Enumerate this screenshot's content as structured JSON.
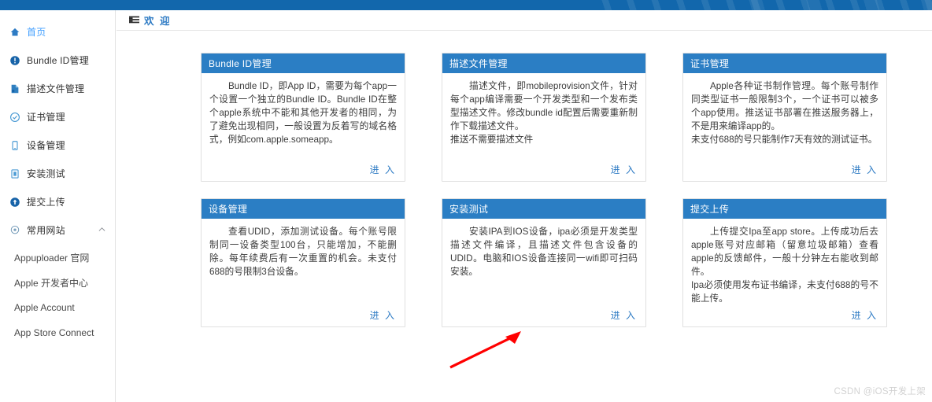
{
  "theme": {
    "topbar_bg": "#1267ac",
    "accent": "#2e7bc4",
    "card_header_bg": "#2b7ec4",
    "active_nav": "#409eff",
    "arrow": "#ff0000",
    "watermark": "#d2d2d2"
  },
  "sidebar": {
    "items": [
      {
        "label": "首页",
        "icon": "home-icon",
        "active": true
      },
      {
        "label": "Bundle ID管理",
        "icon": "info-circle-icon",
        "active": false
      },
      {
        "label": "描述文件管理",
        "icon": "file-profile-icon",
        "active": false
      },
      {
        "label": "证书管理",
        "icon": "check-circle-icon",
        "active": false
      },
      {
        "label": "设备管理",
        "icon": "mobile-device-icon",
        "active": false
      },
      {
        "label": "安装测试",
        "icon": "clipboard-install-icon",
        "active": false
      },
      {
        "label": "提交上传",
        "icon": "upload-circle-icon",
        "active": false
      },
      {
        "label": "常用网站",
        "icon": "location-pin-icon",
        "active": false,
        "expandable": true,
        "caret": "chevron-up-icon"
      }
    ],
    "sub_items": [
      {
        "label": "Appuploader 官网"
      },
      {
        "label": "Apple 开发者中心"
      },
      {
        "label": "Apple Account"
      },
      {
        "label": "App Store Connect"
      }
    ]
  },
  "main": {
    "tab": {
      "icon": "list-menu-icon",
      "label": "欢 迎"
    },
    "cards": [
      {
        "title": "Bundle ID管理",
        "text": "Bundle ID，即App ID，需要为每个app一个设置一个独立的Bundle ID。Bundle ID在整个apple系统中不能和其他开发者的相同，为了避免出现相同，一般设置为反着写的域名格式，例如com.apple.someapp。",
        "action": "进 入"
      },
      {
        "title": "描述文件管理",
        "text": "描述文件，即mobileprovision文件，针对每个app编译需要一个开发类型和一个发布类型描述文件。修改bundle id配置后需要重新制作下载描述文件。\n   推送不需要描述文件",
        "action": "进 入"
      },
      {
        "title": "证书管理",
        "text": "Apple各种证书制作管理。每个账号制作同类型证书一般限制3个，一个证书可以被多个app使用。推送证书部署在推送服务器上，不是用来编译app的。\n   未支付688的号只能制作7天有效的测试证书。",
        "action": "进 入"
      },
      {
        "title": "设备管理",
        "text": "查看UDID，添加测试设备。每个账号限制同一设备类型100台，只能增加，不能删除。每年续费后有一次重置的机会。未支付688的号限制3台设备。",
        "action": "进 入"
      },
      {
        "title": "安装测试",
        "text": "安装IPA到IOS设备，ipa必须是开发类型描述文件编译，且描述文件包含设备的UDID。电脑和IOS设备连接同一wifi即可扫码安装。",
        "action": "进 入"
      },
      {
        "title": "提交上传",
        "text": "上传提交Ipa至app store。上传成功后去apple账号对应邮箱（留意垃圾邮箱）查看apple的反馈邮件，一般十分钟左右能收到邮件。\n   Ipa必须使用发布证书编译，未支付688的号不能上传。",
        "action": "进 入"
      }
    ]
  },
  "annotation": {
    "arrow": "red-arrow-pointer",
    "target_card_index": 3
  },
  "watermark": "CSDN @iOS开发上架"
}
